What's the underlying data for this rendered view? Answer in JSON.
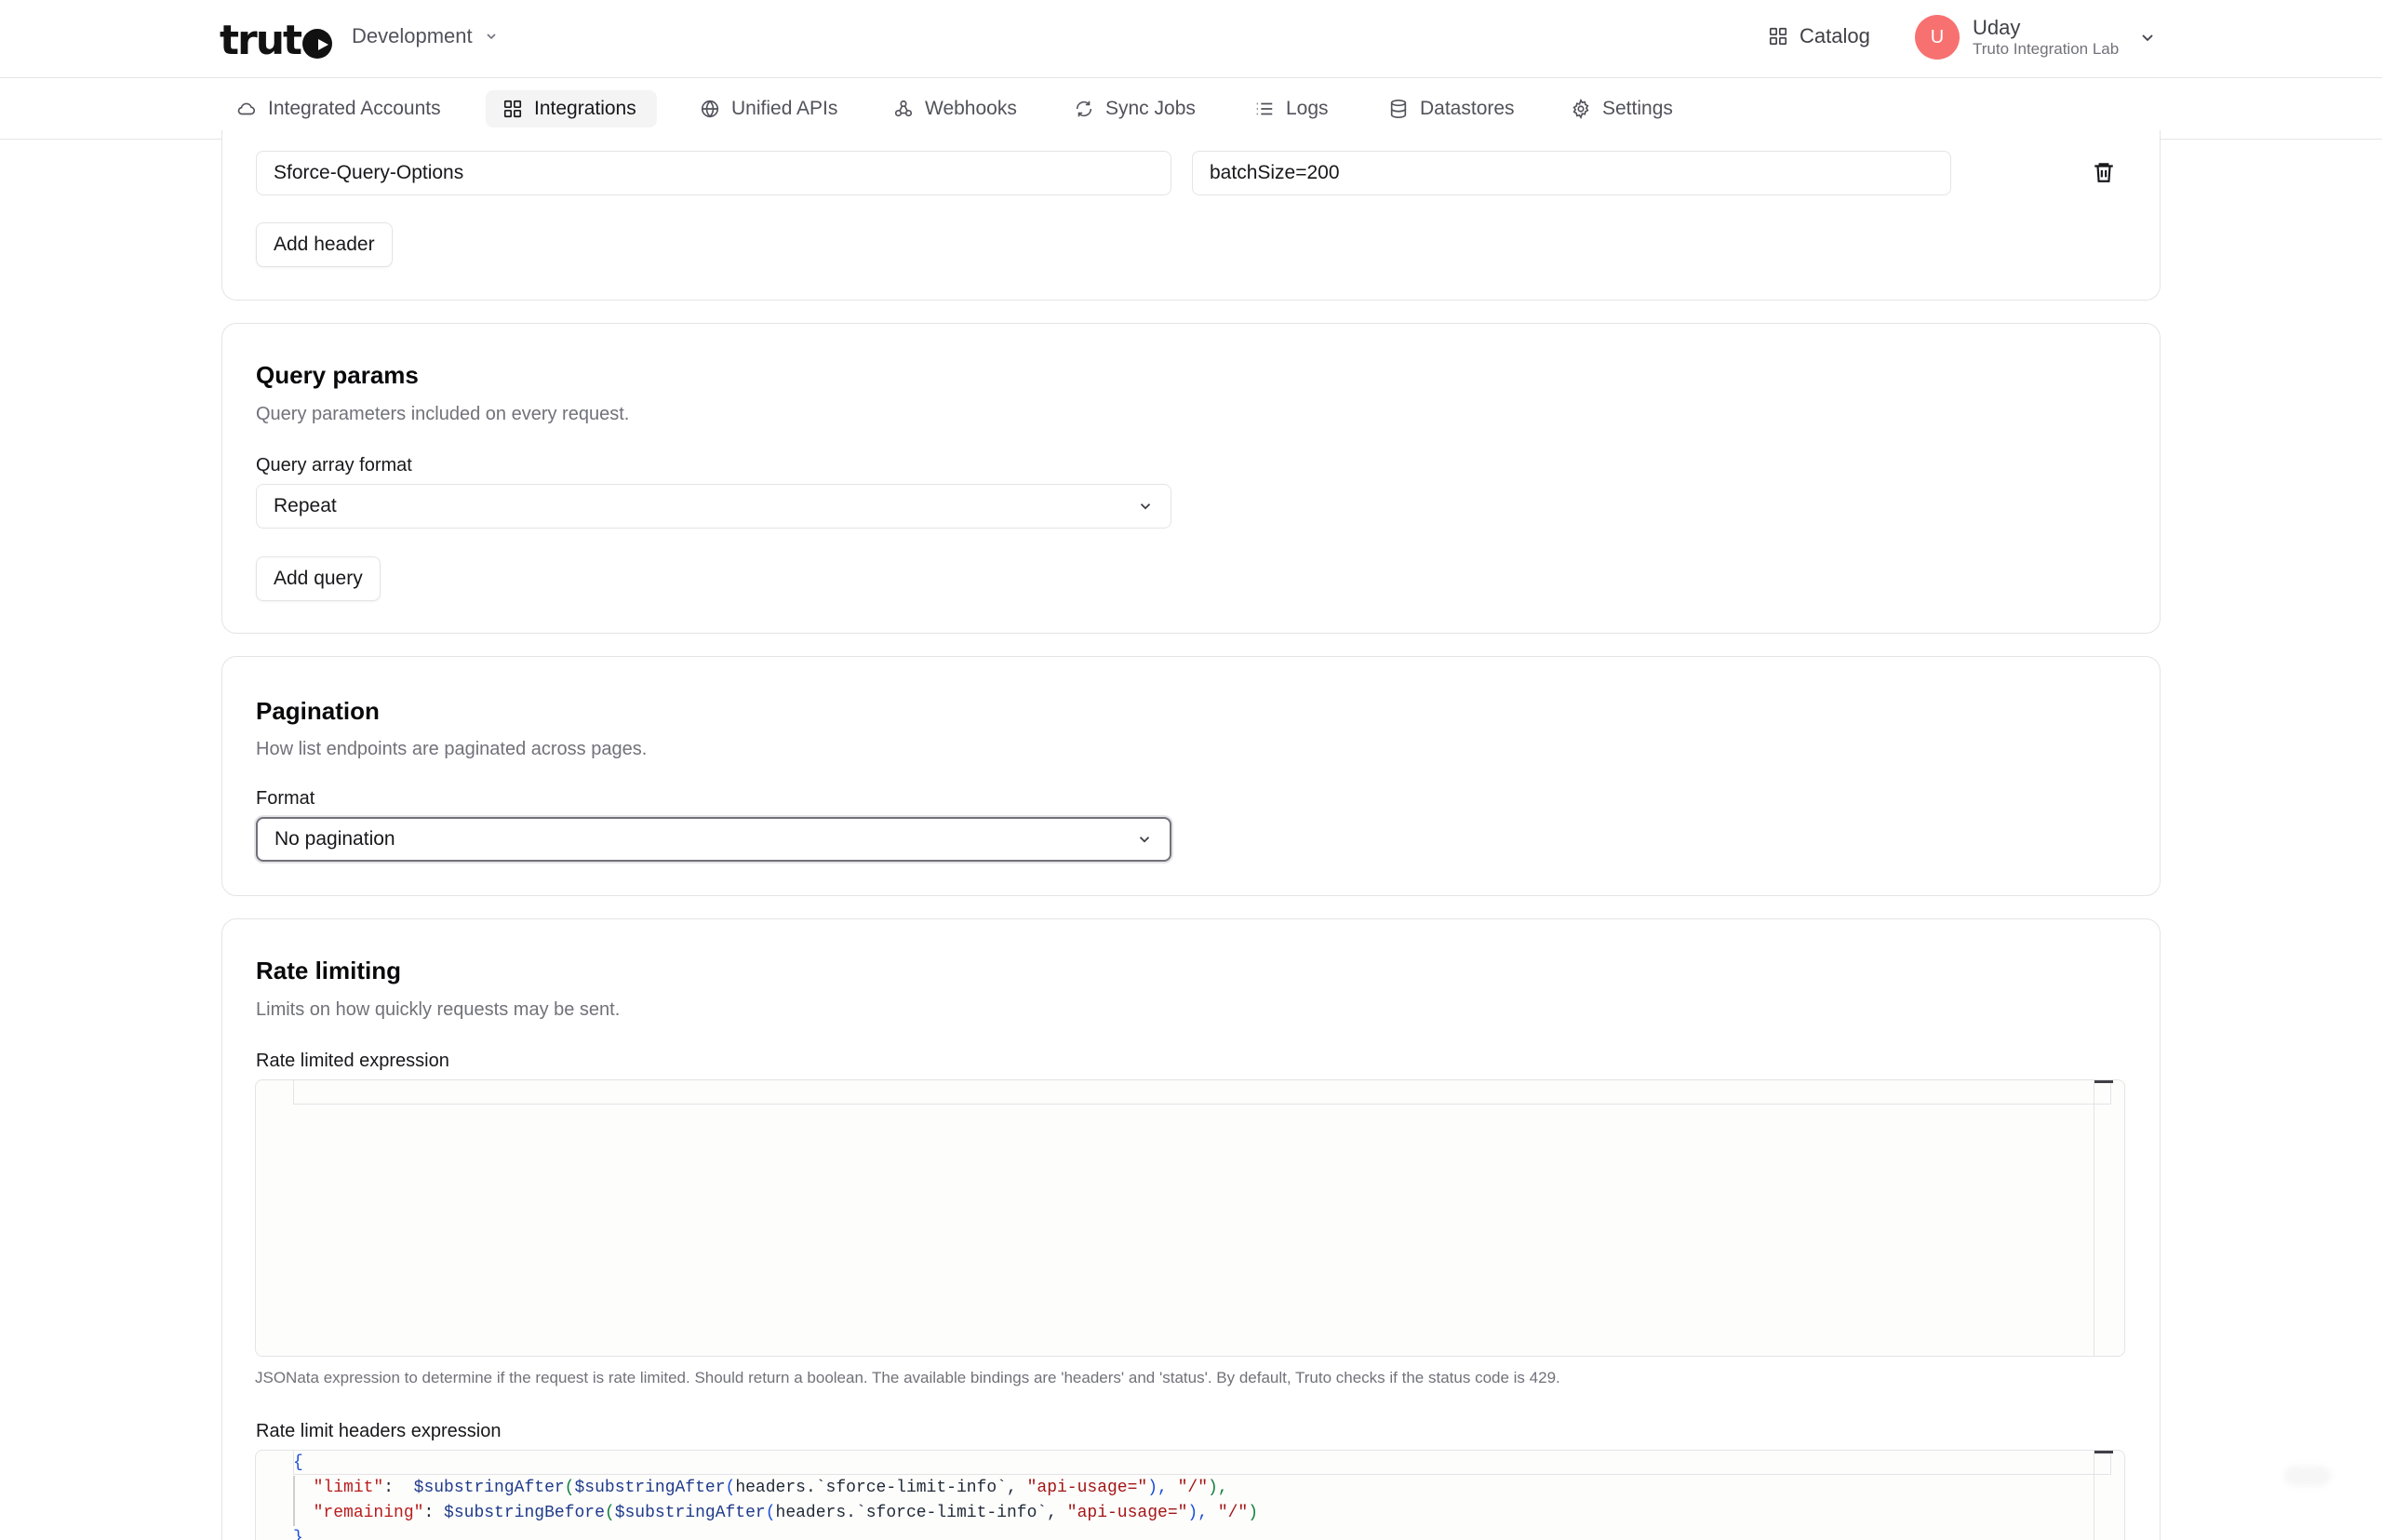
{
  "header": {
    "logo_text": "truto",
    "environment": "Development",
    "catalog_label": "Catalog",
    "user": {
      "initial": "U",
      "name": "Uday",
      "org": "Truto Integration Lab"
    }
  },
  "nav": {
    "items": [
      {
        "label": "Integrated Accounts",
        "icon": "cloud-icon"
      },
      {
        "label": "Integrations",
        "icon": "grid-icon",
        "active": true
      },
      {
        "label": "Unified APIs",
        "icon": "globe-icon"
      },
      {
        "label": "Webhooks",
        "icon": "webhook-icon"
      },
      {
        "label": "Sync Jobs",
        "icon": "sync-icon"
      },
      {
        "label": "Logs",
        "icon": "list-icon"
      },
      {
        "label": "Datastores",
        "icon": "database-icon"
      },
      {
        "label": "Settings",
        "icon": "gear-icon"
      }
    ]
  },
  "headers_section": {
    "row": {
      "key": "Sforce-Query-Options",
      "value": "batchSize=200"
    },
    "add_button": "Add header"
  },
  "query_params": {
    "title": "Query params",
    "description": "Query parameters included on every request.",
    "array_format_label": "Query array format",
    "array_format_value": "Repeat",
    "add_button": "Add query"
  },
  "pagination": {
    "title": "Pagination",
    "description": "How list endpoints are paginated across pages.",
    "format_label": "Format",
    "format_value": "No pagination"
  },
  "rate_limiting": {
    "title": "Rate limiting",
    "description": "Limits on how quickly requests may be sent.",
    "expression_label": "Rate limited expression",
    "expression_help": "JSONata expression to determine if the request is rate limited. Should return a boolean. The available bindings are 'headers' and 'status'. By default, Truto checks if the status code is 429.",
    "headers_label": "Rate limit headers expression",
    "headers_code": {
      "open": "{",
      "line1_key": "\"limit\"",
      "line1_colon": ":  ",
      "line1_fn1": "$substringAfter",
      "line1_p1": "(",
      "line1_fn2": "$substringAfter",
      "line1_p2": "(",
      "line1_arg": "headers.`sforce-limit-info`, ",
      "line1_s1": "\"api-usage=\"",
      "line1_p3": "), ",
      "line1_s2": "\"/\"",
      "line1_p4": "),",
      "line2_key": "\"remaining\"",
      "line2_colon": ": ",
      "line2_fn1": "$substringBefore",
      "line2_p1": "(",
      "line2_fn2": "$substringAfter",
      "line2_p2": "(",
      "line2_arg": "headers.`sforce-limit-info`, ",
      "line2_s1": "\"api-usage=\"",
      "line2_p3": "), ",
      "line2_s2": "\"/\"",
      "line2_p4": ")",
      "close": "}"
    }
  },
  "colors": {
    "accent": "#18181b",
    "avatar": "#f87171",
    "border": "#e4e4e7",
    "muted_text": "#71717a"
  }
}
